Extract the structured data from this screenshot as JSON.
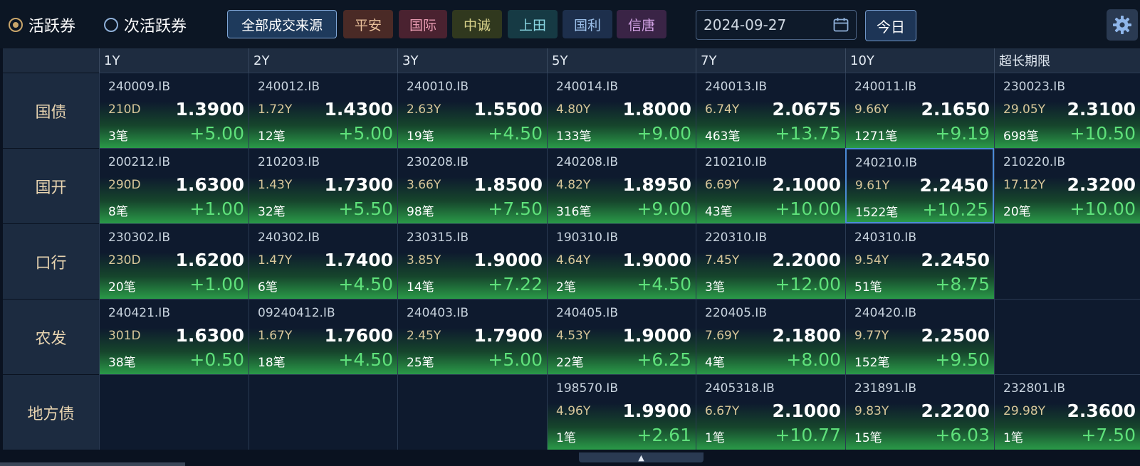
{
  "toolbar": {
    "radio_active": "活跃券",
    "radio_secondary": "次活跃券",
    "sources": [
      "全部成交来源",
      "平安",
      "国际",
      "中诚",
      "上田",
      "国利",
      "信唐"
    ],
    "date": "2024-09-27",
    "today_label": "今日"
  },
  "columns": [
    "1Y",
    "2Y",
    "3Y",
    "5Y",
    "7Y",
    "10Y",
    "超长期限"
  ],
  "rows": [
    {
      "label": "国债",
      "cells": [
        {
          "code": "240009.IB",
          "term": "210D",
          "rate": "1.3900",
          "count": "3笔",
          "change": "+5.00"
        },
        {
          "code": "240012.IB",
          "term": "1.72Y",
          "rate": "1.4300",
          "count": "12笔",
          "change": "+5.00"
        },
        {
          "code": "240010.IB",
          "term": "2.63Y",
          "rate": "1.5500",
          "count": "19笔",
          "change": "+4.50"
        },
        {
          "code": "240014.IB",
          "term": "4.80Y",
          "rate": "1.8000",
          "count": "133笔",
          "change": "+9.00"
        },
        {
          "code": "240013.IB",
          "term": "6.74Y",
          "rate": "2.0675",
          "count": "463笔",
          "change": "+13.75"
        },
        {
          "code": "240011.IB",
          "term": "9.66Y",
          "rate": "2.1650",
          "count": "1271笔",
          "change": "+9.19"
        },
        {
          "code": "230023.IB",
          "term": "29.05Y",
          "rate": "2.3100",
          "count": "698笔",
          "change": "+10.50"
        }
      ]
    },
    {
      "label": "国开",
      "cells": [
        {
          "code": "200212.IB",
          "term": "290D",
          "rate": "1.6300",
          "count": "8笔",
          "change": "+1.00"
        },
        {
          "code": "210203.IB",
          "term": "1.43Y",
          "rate": "1.7300",
          "count": "32笔",
          "change": "+5.50"
        },
        {
          "code": "230208.IB",
          "term": "3.66Y",
          "rate": "1.8500",
          "count": "98笔",
          "change": "+7.50"
        },
        {
          "code": "240208.IB",
          "term": "4.82Y",
          "rate": "1.8950",
          "count": "316笔",
          "change": "+9.00"
        },
        {
          "code": "210210.IB",
          "term": "6.69Y",
          "rate": "2.1000",
          "count": "43笔",
          "change": "+10.00"
        },
        {
          "code": "240210.IB",
          "term": "9.61Y",
          "rate": "2.2450",
          "count": "1522笔",
          "change": "+10.25",
          "selected": true
        },
        {
          "code": "210220.IB",
          "term": "17.12Y",
          "rate": "2.3200",
          "count": "20笔",
          "change": "+10.00"
        }
      ]
    },
    {
      "label": "口行",
      "cells": [
        {
          "code": "230302.IB",
          "term": "230D",
          "rate": "1.6200",
          "count": "20笔",
          "change": "+1.00"
        },
        {
          "code": "240302.IB",
          "term": "1.47Y",
          "rate": "1.7400",
          "count": "6笔",
          "change": "+4.50"
        },
        {
          "code": "230315.IB",
          "term": "3.85Y",
          "rate": "1.9000",
          "count": "14笔",
          "change": "+7.22"
        },
        {
          "code": "190310.IB",
          "term": "4.64Y",
          "rate": "1.9000",
          "count": "2笔",
          "change": "+4.50"
        },
        {
          "code": "220310.IB",
          "term": "7.45Y",
          "rate": "2.2000",
          "count": "3笔",
          "change": "+12.00"
        },
        {
          "code": "240310.IB",
          "term": "9.54Y",
          "rate": "2.2450",
          "count": "51笔",
          "change": "+8.75"
        },
        null
      ]
    },
    {
      "label": "农发",
      "cells": [
        {
          "code": "240421.IB",
          "term": "301D",
          "rate": "1.6300",
          "count": "38笔",
          "change": "+0.50"
        },
        {
          "code": "09240412.IB",
          "term": "1.67Y",
          "rate": "1.7600",
          "count": "18笔",
          "change": "+4.50"
        },
        {
          "code": "240403.IB",
          "term": "2.45Y",
          "rate": "1.7900",
          "count": "25笔",
          "change": "+5.00"
        },
        {
          "code": "240405.IB",
          "term": "4.53Y",
          "rate": "1.9000",
          "count": "22笔",
          "change": "+6.25"
        },
        {
          "code": "220405.IB",
          "term": "7.69Y",
          "rate": "2.1800",
          "count": "4笔",
          "change": "+8.00"
        },
        {
          "code": "240420.IB",
          "term": "9.77Y",
          "rate": "2.2500",
          "count": "152笔",
          "change": "+9.50"
        },
        null
      ]
    },
    {
      "label": "地方债",
      "cells": [
        null,
        null,
        null,
        {
          "code": "198570.IB",
          "term": "4.96Y",
          "rate": "1.9900",
          "count": "1笔",
          "change": "+2.61"
        },
        {
          "code": "2405318.IB",
          "term": "6.67Y",
          "rate": "2.1000",
          "count": "1笔",
          "change": "+10.77"
        },
        {
          "code": "231891.IB",
          "term": "9.83Y",
          "rate": "2.2200",
          "count": "15笔",
          "change": "+6.03"
        },
        {
          "code": "232801.IB",
          "term": "29.98Y",
          "rate": "2.3600",
          "count": "1笔",
          "change": "+7.50"
        }
      ]
    }
  ],
  "pull_tab_glyph": "▲",
  "colors": {
    "up": "#5ee07a",
    "selected_border": "#4a8ad6",
    "background": "#0a1220"
  }
}
